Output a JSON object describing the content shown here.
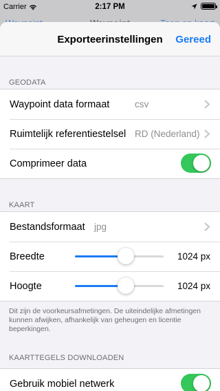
{
  "status_bar": {
    "carrier": "Carrier",
    "time": "2:17 PM",
    "icons": [
      "wifi-icon",
      "location-arrow-icon",
      "battery-icon"
    ]
  },
  "underlay_nav": {
    "back_label": "Waypoint",
    "title": "Waypoint",
    "right_label": "Toon op kaart"
  },
  "sheet": {
    "title": "Exporteerinstellingen",
    "done_label": "Gereed"
  },
  "geodata": {
    "header": "GEODATA",
    "format_label": "Waypoint data formaat",
    "format_value": "csv",
    "crs_label": "Ruimtelijk referentiestelsel",
    "crs_value": "RD (Nederland)",
    "compress_label": "Comprimeer data",
    "compress_on": true
  },
  "kaart": {
    "header": "KAART",
    "fileformat_label": "Bestandsformaat",
    "fileformat_value": "jpg",
    "width_label": "Breedte",
    "width_value": "1024 px",
    "width_fraction": 0.57,
    "height_label": "Hoogte",
    "height_value": "1024 px",
    "height_fraction": 0.57,
    "footnote": "Dit zijn de voorkeursafmetingen. De uiteindelijke afmetingen kunnen afwijken, afhankelijk van geheugen en licentie beperkingen."
  },
  "tiles": {
    "header": "KAARTTEGELS DOWNLOADEN",
    "mobile_label": "Gebruik mobiel netwerk",
    "mobile_on": true
  },
  "colors": {
    "accent": "#1a7cf5",
    "toggle_on": "#34c759",
    "secondary_text": "#8e8e93"
  }
}
